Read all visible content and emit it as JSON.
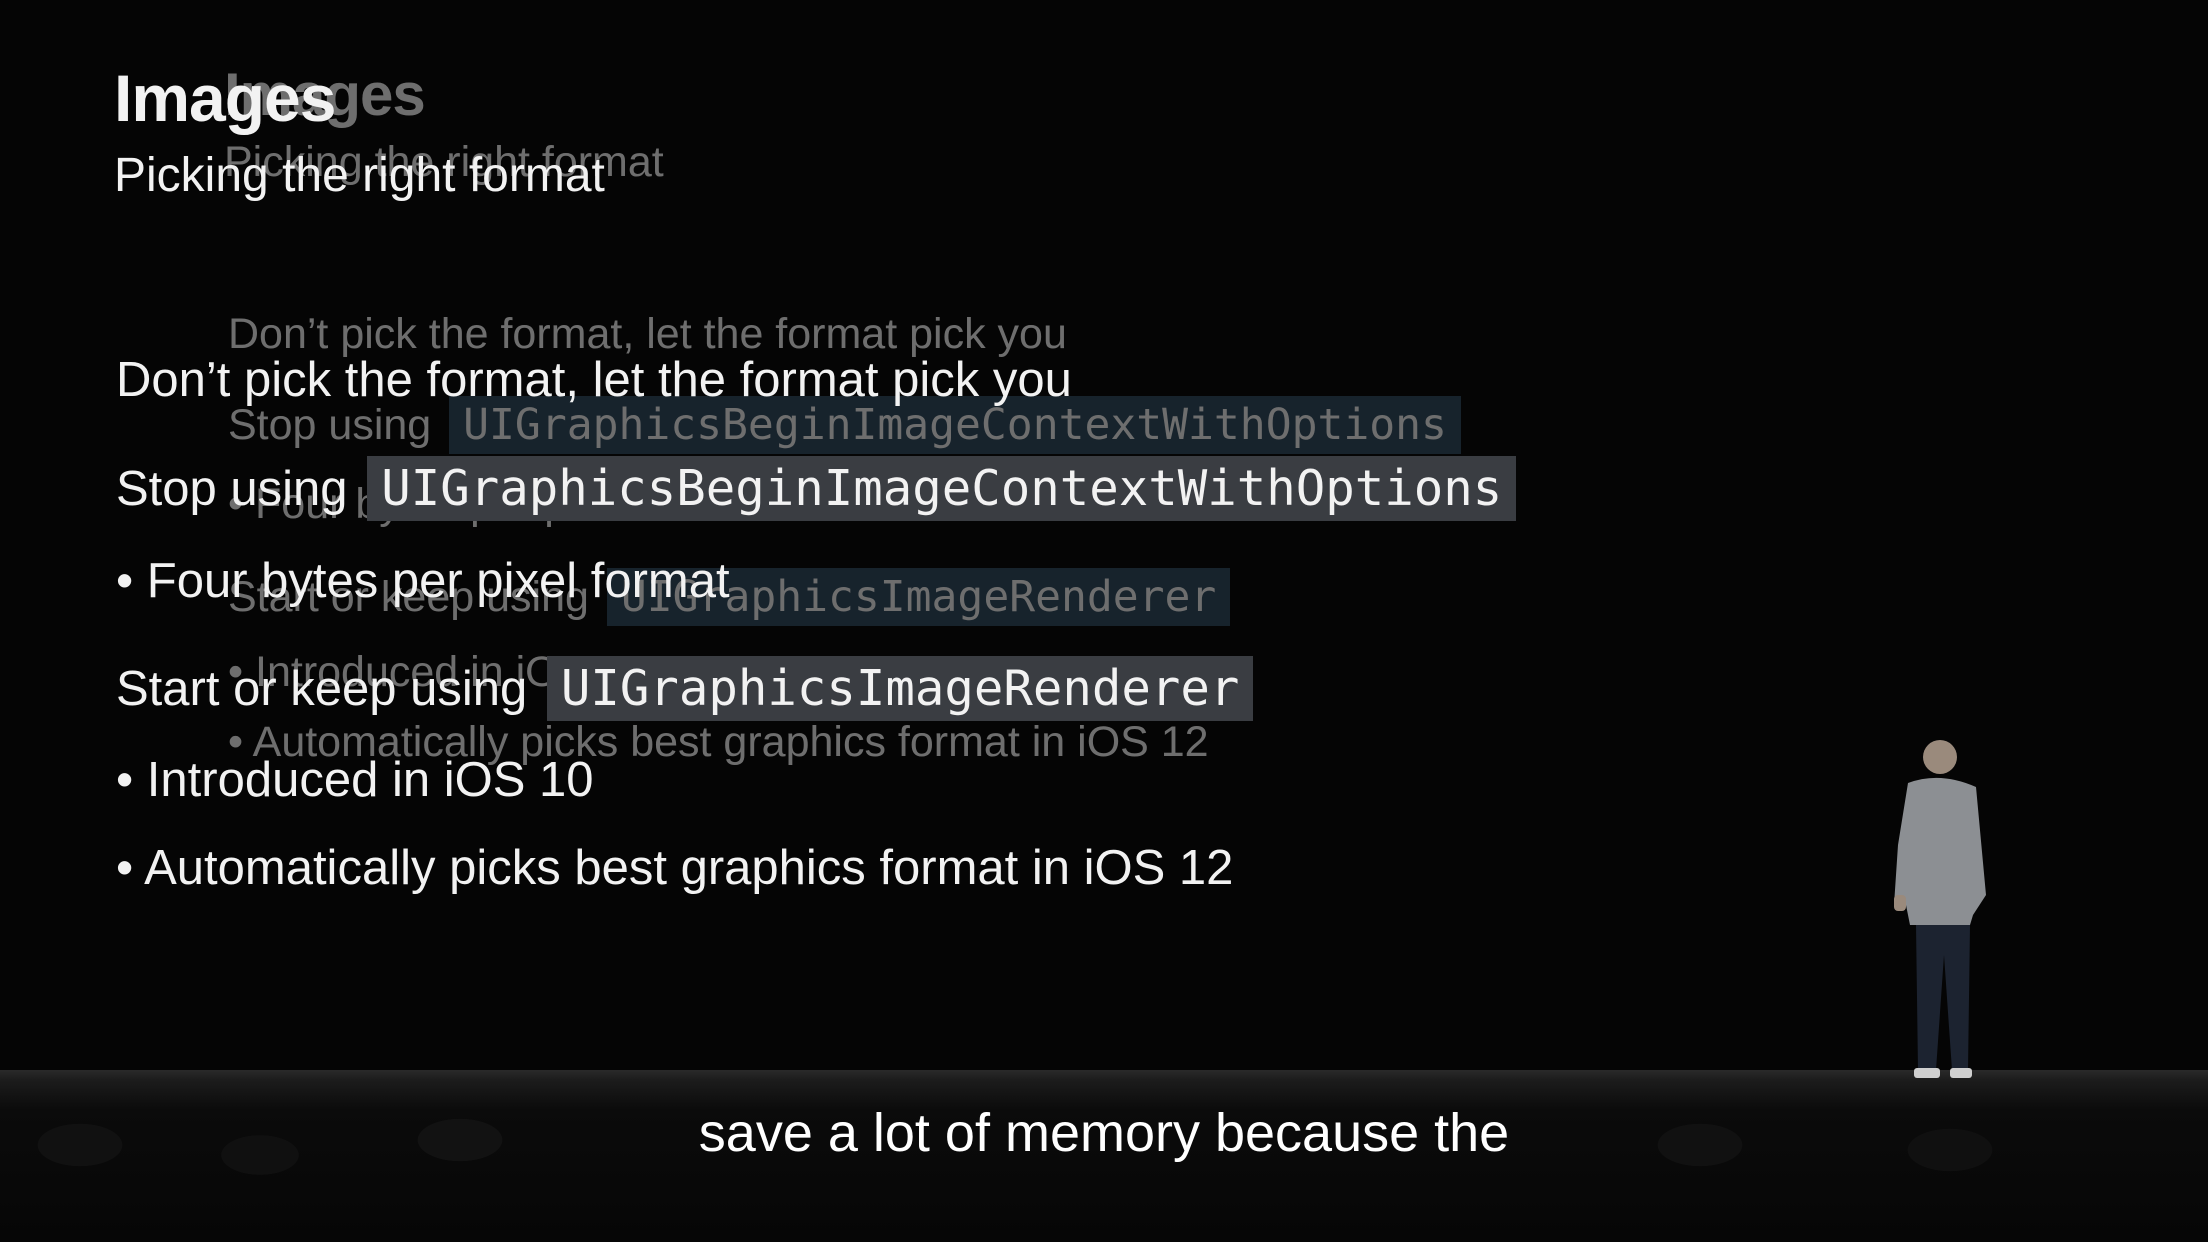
{
  "slide": {
    "title": "Images",
    "subtitle": "Picking the right format",
    "line1": "Don’t pick the format, let the format pick you",
    "line2_prefix": "Stop using",
    "line2_code": "UIGraphicsBeginImageContextWithOptions",
    "bullet1": "Four bytes per pixel format",
    "line3_prefix": "Start or keep using",
    "line3_code": "UIGraphicsImageRenderer",
    "bullet2": "Introduced in iOS 10",
    "bullet3": "Automatically picks best graphics format in iOS 12"
  },
  "caption": "save a lot of memory because the"
}
